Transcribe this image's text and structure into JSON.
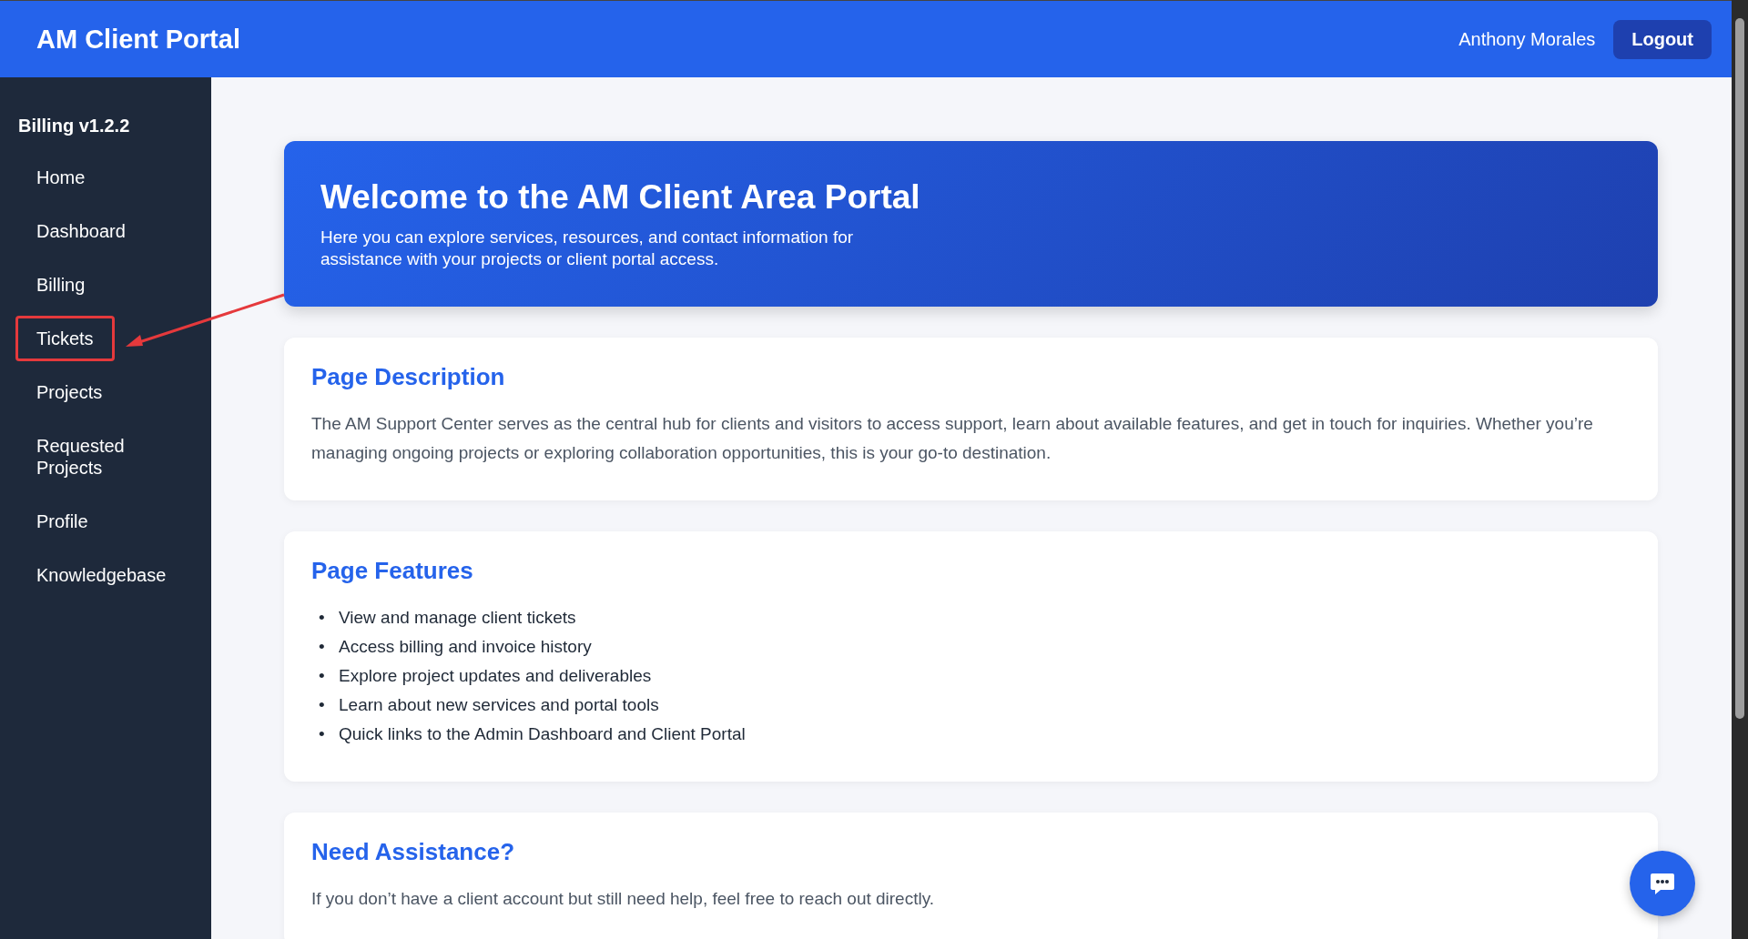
{
  "header": {
    "title": "AM Client Portal",
    "user_name": "Anthony Morales",
    "logout_label": "Logout"
  },
  "sidebar": {
    "title": "Billing v1.2.2",
    "items": [
      {
        "label": "Home",
        "annotated": false
      },
      {
        "label": "Dashboard",
        "annotated": false
      },
      {
        "label": "Billing",
        "annotated": false
      },
      {
        "label": "Tickets",
        "annotated": true
      },
      {
        "label": "Projects",
        "annotated": false
      },
      {
        "label": "Requested Projects",
        "annotated": false
      },
      {
        "label": "Profile",
        "annotated": false
      },
      {
        "label": "Knowledgebase",
        "annotated": false
      }
    ]
  },
  "hero": {
    "title": "Welcome to the AM Client Area Portal",
    "text": "Here you can explore services, resources, and contact information for assistance with your projects or client portal access."
  },
  "sections": [
    {
      "kind": "paragraph",
      "title": "Page Description",
      "text": "The AM Support Center serves as the central hub for clients and visitors to access support, learn about available features, and get in touch for inquiries. Whether you’re managing ongoing projects or exploring collaboration opportunities, this is your go-to destination."
    },
    {
      "kind": "list",
      "title": "Page Features",
      "items": [
        {
          "bullet": "•",
          "text": "View and manage client tickets"
        },
        {
          "bullet": "•",
          "text": "Access billing and invoice history"
        },
        {
          "bullet": "•",
          "text": "Explore project updates and deliverables"
        },
        {
          "bullet": "•",
          "text": "Learn about new services and portal tools"
        },
        {
          "bullet": "•",
          "text": "Quick links to the Admin Dashboard and Client Portal"
        }
      ]
    },
    {
      "kind": "paragraph",
      "title": "Need Assistance?",
      "text": "If you don’t have a client account but still need help, feel free to reach out directly."
    }
  ]
}
